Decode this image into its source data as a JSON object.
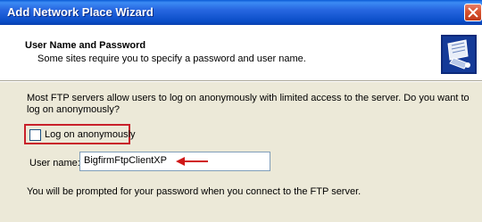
{
  "window": {
    "title": "Add Network Place Wizard"
  },
  "header": {
    "title": "User Name and Password",
    "subtitle": "Some sites require you to specify a password and user name.",
    "icon": "network-place-wizard-icon"
  },
  "body": {
    "intro": "Most FTP servers allow users to log on anonymously with limited access to the server.  Do you want to log on anonymously?",
    "anonymous_checkbox": {
      "label": "Log on anonymously",
      "checked": false
    },
    "username": {
      "label": "User name:",
      "value": "BigfirmFtpClientXP"
    },
    "prompt": "You will be prompted for your password when you connect to the FTP server."
  },
  "colors": {
    "titlebar": "#0a4ec8",
    "highlight": "#c8202a",
    "arrow": "#d01818",
    "background": "#ece9d8"
  }
}
